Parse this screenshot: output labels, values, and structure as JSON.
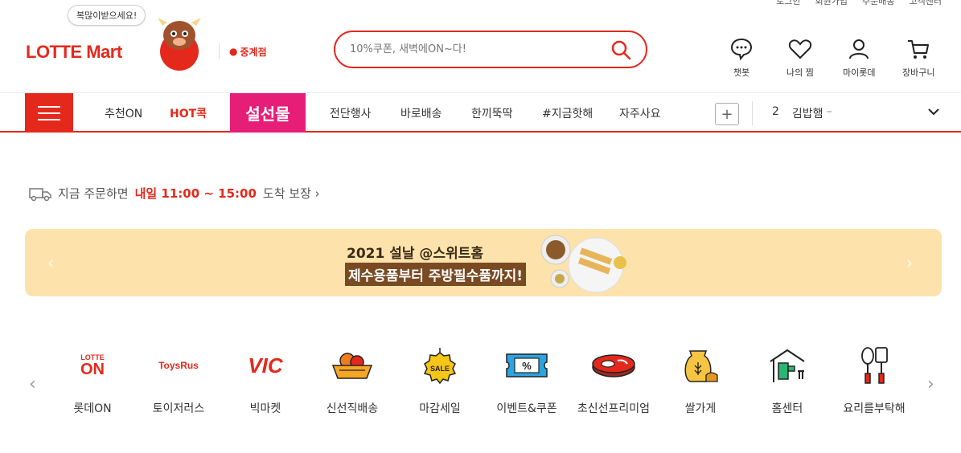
{
  "util_links": [
    "로그인",
    "회원가입",
    "주문배송",
    "고객센터"
  ],
  "header": {
    "logo_text": "LOTTE Mart",
    "bubble": "복많이받으세요!",
    "store": "중계점",
    "search_placeholder": "10%쿠폰, 새벽에ON~다!",
    "icons": [
      {
        "label": "챗봇",
        "icon": "chatbot-icon"
      },
      {
        "label": "나의 찜",
        "icon": "heart-icon"
      },
      {
        "label": "마이롯데",
        "icon": "user-icon"
      },
      {
        "label": "장바구니",
        "icon": "cart-icon"
      }
    ]
  },
  "gnb": {
    "items": [
      "추천ON",
      "HOT콕",
      "전단행사",
      "바로배송",
      "한끼뚝딱",
      "#지금핫해",
      "자주사요"
    ],
    "promo_label": "설선물",
    "rank_number": "2",
    "rank_text": "김밥햄",
    "rank_dash": "–"
  },
  "delivery": {
    "prefix": "지금 주문하면",
    "highlight": "내일 11:00 ~ 15:00",
    "suffix": "도착 보장 ›"
  },
  "banner": {
    "line1": "2021 설날 @스위트홈",
    "line2": "제수용품부터 주방필수품까지!"
  },
  "categories": [
    {
      "label": "롯데ON",
      "icon": "lotteon-logo"
    },
    {
      "label": "토이저러스",
      "icon": "toysrus-logo"
    },
    {
      "label": "빅마켓",
      "icon": "vic-logo"
    },
    {
      "label": "신선직배송",
      "icon": "fruit-basket-icon"
    },
    {
      "label": "마감세일",
      "icon": "sale-tag-icon"
    },
    {
      "label": "이벤트&쿠폰",
      "icon": "coupon-icon"
    },
    {
      "label": "초신선프리미엄",
      "icon": "meat-icon"
    },
    {
      "label": "쌀가게",
      "icon": "rice-bag-icon"
    },
    {
      "label": "홈센터",
      "icon": "home-tools-icon"
    },
    {
      "label": "요리를부탁해",
      "icon": "cooking-tools-icon"
    }
  ],
  "logo_texts": {
    "lotte": "LOTTE",
    "on": "ON",
    "toys": "ToysRus",
    "vic": "VIC",
    "sale": "SALE",
    "pct": "%"
  },
  "colors": {
    "brand": "#e5281c",
    "promo": "#e61e78",
    "banner_bg": "#fde3ab"
  }
}
